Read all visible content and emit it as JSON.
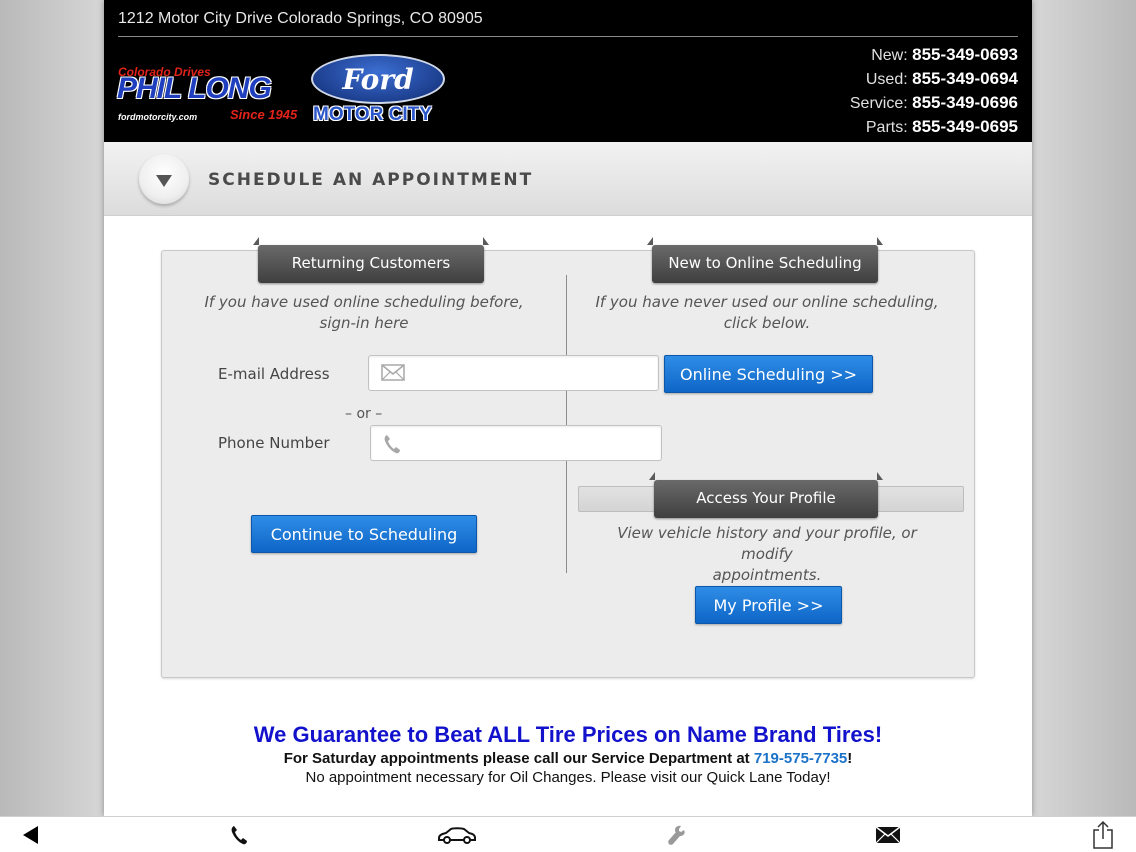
{
  "header": {
    "address": "1212 Motor City Drive  Colorado Springs,  CO  80905",
    "logo": {
      "tagline": "Colorado Drives",
      "dealer": "PHIL LONG",
      "since": "Since 1945",
      "url": "fordmotorcity.com",
      "brand": "Ford",
      "brand_sub": "MOTOR CITY"
    },
    "phones": [
      {
        "label": "New:",
        "number": "855-349-0693"
      },
      {
        "label": "Used:",
        "number": "855-349-0694"
      },
      {
        "label": "Service:",
        "number": "855-349-0696"
      },
      {
        "label": "Parts:",
        "number": "855-349-0695"
      }
    ]
  },
  "section": {
    "title": "SCHEDULE AN APPOINTMENT",
    "collapse_icon": "triangle-down-icon"
  },
  "returning": {
    "tab": "Returning Customers",
    "note_line1": "If you have used online scheduling before,",
    "note_line2": "sign-in here",
    "email_label": "E-mail Address",
    "email_value": "",
    "email_icon": "envelope-icon",
    "or": "– or –",
    "phone_label": "Phone Number",
    "phone_value": "",
    "phone_icon": "phone-icon",
    "continue_button": "Continue to Scheduling"
  },
  "new_user": {
    "tab": "New to Online Scheduling",
    "note_line1": "If you have never used our online scheduling,",
    "note_line2": "click below.",
    "button": "Online Scheduling >>"
  },
  "profile": {
    "tab": "Access Your Profile",
    "note_line1": "View vehicle history and your profile, or modify",
    "note_line2": "appointments.",
    "button": "My Profile >>"
  },
  "promo": {
    "title": "We Guarantee to Beat ALL Tire Prices on Name Brand Tires!",
    "line2_prefix": "For Saturday appointments please call our Service Department at ",
    "line2_phone": "719-575-7735",
    "line2_suffix": "!",
    "line3": "No appointment necessary for Oil Changes. Please visit our Quick Lane Today!"
  },
  "toolbar": {
    "icons": [
      "back-arrow-icon",
      "phone-icon",
      "car-icon",
      "wrench-icon",
      "envelope-icon",
      "share-icon"
    ]
  },
  "colors": {
    "accent_blue": "#0e66c7",
    "promo_blue": "#1212cc",
    "header_bg": "#000000"
  }
}
